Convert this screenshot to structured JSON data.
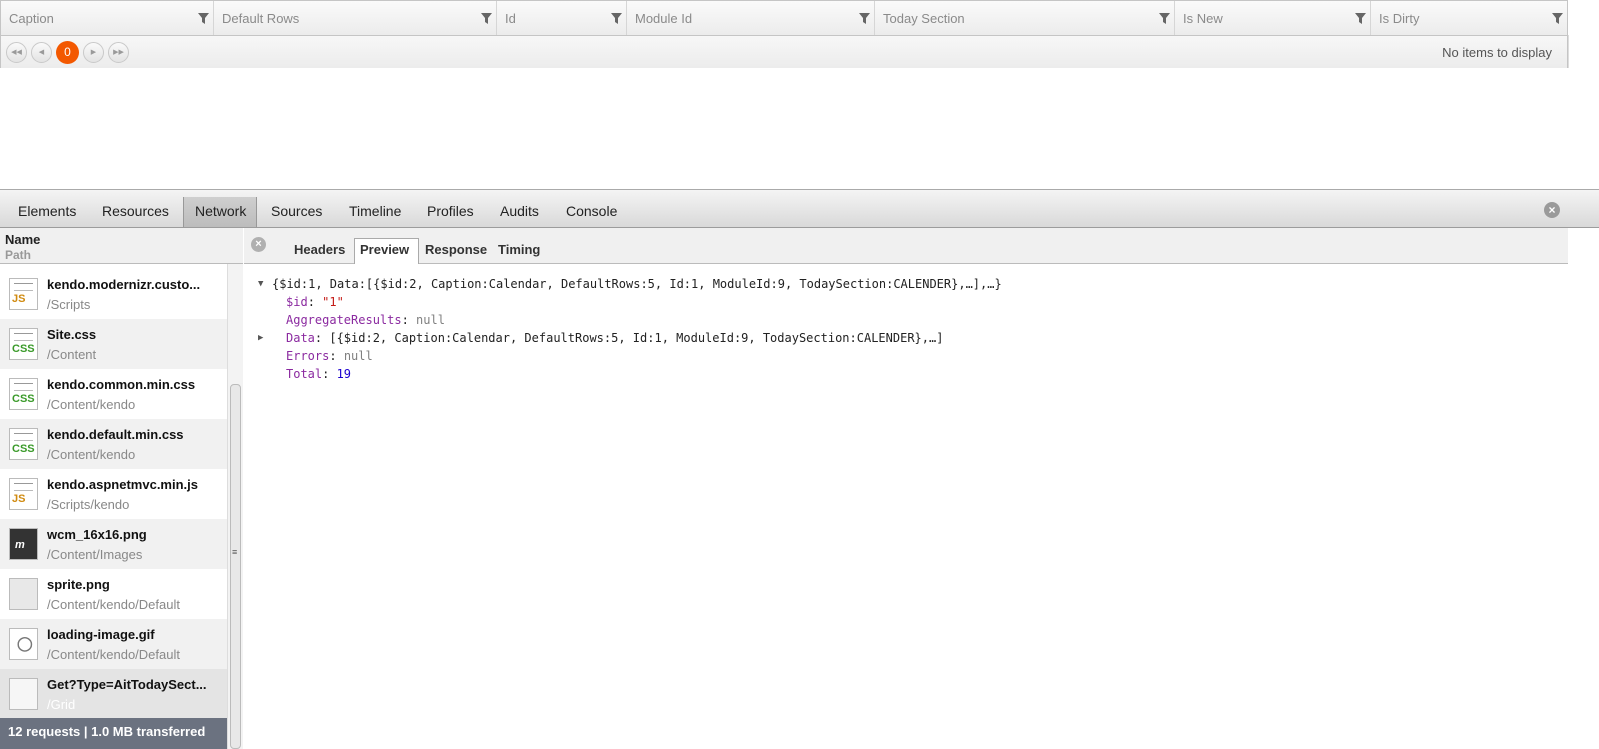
{
  "grid": {
    "columns": [
      {
        "label": "Caption"
      },
      {
        "label": "Default Rows"
      },
      {
        "label": "Id"
      },
      {
        "label": "Module Id"
      },
      {
        "label": "Today Section"
      },
      {
        "label": "Is New"
      },
      {
        "label": "Is Dirty"
      }
    ],
    "pager": {
      "current_page": "0",
      "status": "No items to display"
    }
  },
  "devtools": {
    "tabs": [
      "Elements",
      "Resources",
      "Network",
      "Sources",
      "Timeline",
      "Profiles",
      "Audits",
      "Console"
    ],
    "active_tab": "Network",
    "left_pane": {
      "name_header": "Name",
      "path_header": "Path",
      "requests": [
        {
          "name": "kendo.modernizr.custo...",
          "path": "/Scripts",
          "type": "JS"
        },
        {
          "name": "Site.css",
          "path": "/Content",
          "type": "CSS"
        },
        {
          "name": "kendo.common.min.css",
          "path": "/Content/kendo",
          "type": "CSS"
        },
        {
          "name": "kendo.default.min.css",
          "path": "/Content/kendo",
          "type": "CSS"
        },
        {
          "name": "kendo.aspnetmvc.min.js",
          "path": "/Scripts/kendo",
          "type": "JS"
        },
        {
          "name": "wcm_16x16.png",
          "path": "/Content/Images",
          "type": "IMG"
        },
        {
          "name": "sprite.png",
          "path": "/Content/kendo/Default",
          "type": "IMG"
        },
        {
          "name": "loading-image.gif",
          "path": "/Content/kendo/Default",
          "type": "IMG"
        },
        {
          "name": "Get?Type=AitTodaySect...",
          "path": "/Grid",
          "type": "DOC"
        }
      ],
      "summary": "12 requests  |  1.0 MB transferred"
    },
    "detail_tabs": [
      "Headers",
      "Preview",
      "Response",
      "Timing"
    ],
    "active_detail_tab": "Preview",
    "preview": {
      "root": "{$id:1, Data:[{$id:2, Caption:Calendar, DefaultRows:5, Id:1, ModuleId:9, TodaySection:CALENDER},…],…}",
      "id_key": "$id",
      "id_value": "\"1\"",
      "agg_key": "AggregateResults",
      "agg_value": "null",
      "data_key": "Data",
      "data_value": "[{$id:2, Caption:Calendar, DefaultRows:5, Id:1, ModuleId:9, TodaySection:CALENDER},…]",
      "errors_key": "Errors",
      "errors_value": "null",
      "total_key": "Total",
      "total_value": "19"
    }
  },
  "colors": {
    "pager_accent": "#f35800",
    "json_key": "#8b2aa0",
    "json_string": "#c41a16",
    "json_number": "#1c00cf"
  }
}
